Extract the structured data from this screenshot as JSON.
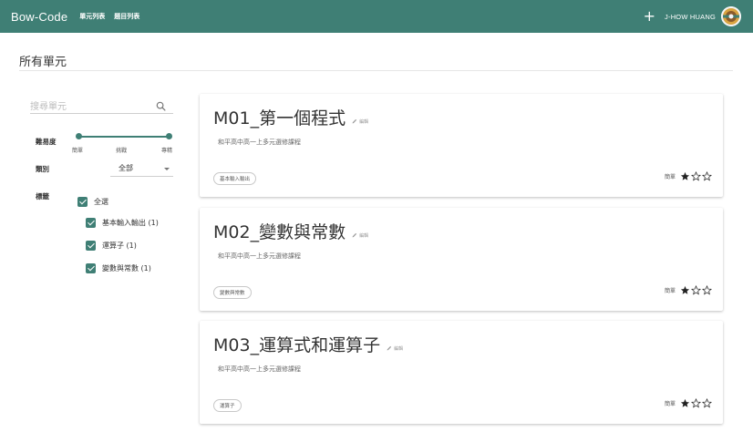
{
  "topbar": {
    "brand": "Bow-Code",
    "nav": [
      "單元列表",
      "題目列表"
    ],
    "add_symbol": "+",
    "username": "J-HOW HUANG",
    "color": "#3f7f75"
  },
  "page": {
    "title": "所有單元"
  },
  "sidebar": {
    "search_placeholder": "搜尋單元",
    "difficulty_label": "難易度",
    "difficulty_ticks": [
      "簡單",
      "挑戰",
      "專精"
    ],
    "category_label": "類別",
    "category_value": "全部",
    "tags_label": "標籤",
    "tags": [
      {
        "label": "全選",
        "checked": true
      },
      {
        "label": "基本輸入輸出 (1)",
        "checked": true
      },
      {
        "label": "運算子 (1)",
        "checked": true
      },
      {
        "label": "變數與常數 (1)",
        "checked": true
      }
    ]
  },
  "cards": [
    {
      "title": "M01_第一個程式",
      "edit": "編輯",
      "desc": "和平高中高一上多元選修課程",
      "chip": "基本輸入輸出",
      "difficulty": "簡單",
      "stars": 1
    },
    {
      "title": "M02_變數與常數",
      "edit": "編輯",
      "desc": "和平高中高一上多元選修課程",
      "chip": "變數與常數",
      "difficulty": "簡單",
      "stars": 1
    },
    {
      "title": "M03_運算式和運算子",
      "edit": "編輯",
      "desc": "和平高中高一上多元選修課程",
      "chip": "運算子",
      "difficulty": "簡單",
      "stars": 1
    }
  ],
  "icons": {
    "search": "search-icon",
    "edit": "pencil-icon",
    "star_filled": "star-icon",
    "star_empty": "star-outline-icon"
  }
}
